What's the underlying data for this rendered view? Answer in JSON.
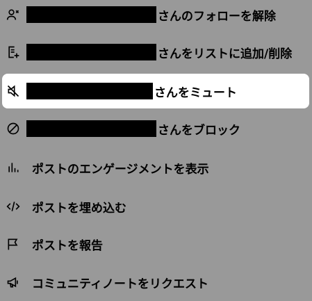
{
  "menu": {
    "items": [
      {
        "icon": "user-unfollow-icon",
        "suffix": "さんのフォローを解除"
      },
      {
        "icon": "list-add-icon",
        "suffix": "さんをリストに追加/削除"
      },
      {
        "icon": "mute-icon",
        "suffix": "さんをミュート"
      },
      {
        "icon": "block-icon",
        "suffix": "さんをブロック"
      },
      {
        "icon": "analytics-icon",
        "label": "ポストのエンゲージメントを表示"
      },
      {
        "icon": "embed-code-icon",
        "label": "ポストを埋め込む"
      },
      {
        "icon": "report-flag-icon",
        "label": "ポストを報告"
      },
      {
        "icon": "megaphone-icon",
        "label": "コミュニティノートをリクエスト"
      }
    ]
  },
  "colors": {
    "overlay_background": "#999999",
    "highlight_background": "#ffffff",
    "text": "#000000",
    "redaction": "#000000"
  }
}
